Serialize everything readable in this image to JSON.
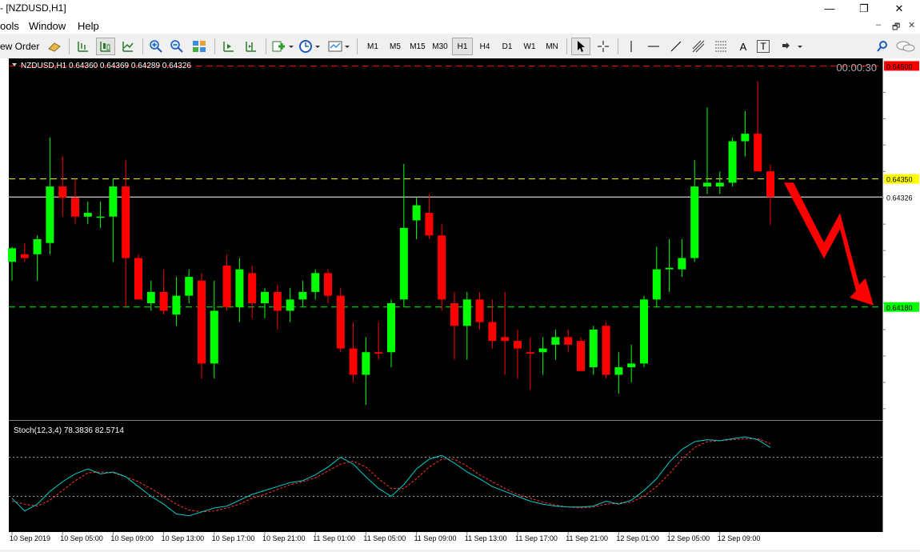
{
  "window": {
    "title": "- [NZDUSD,H1]",
    "buttons": {
      "minimize": "—",
      "maximize": "❐",
      "close": "✕"
    }
  },
  "menu": {
    "items": [
      "ools",
      "Window",
      "Help"
    ],
    "mdi": {
      "minimize": "–",
      "restore": "🗗",
      "close": "✕"
    }
  },
  "toolbar": {
    "new_order_label": "ew Order",
    "timeframes": [
      "M1",
      "M5",
      "M15",
      "M30",
      "H1",
      "H4",
      "D1",
      "W1",
      "MN"
    ],
    "active_timeframe": "H1",
    "text_tool_label": "A",
    "text_label_tool_label": "T",
    "icons": [
      "expert-advisor-icon",
      "bar-chart-icon",
      "candlestick-icon",
      "line-chart-icon",
      "zoom-in-icon",
      "zoom-out-icon",
      "tile-windows-icon",
      "autoscroll-icon",
      "chart-shift-icon",
      "indicators-icon",
      "periodicity-icon",
      "templates-icon",
      "cursor-icon",
      "crosshair-icon",
      "vertical-line-icon",
      "horizontal-line-icon",
      "trendline-icon",
      "channel-icon",
      "fibonacci-icon",
      "text-icon",
      "text-label-icon",
      "arrows-icon",
      "search-icon",
      "chat-icon"
    ]
  },
  "chart_data": {
    "type": "candlestick",
    "symbol_info": "NZDUSD,H1  0.64360 0.64369 0.64289 0.64326",
    "timer": "00:00:30",
    "colors": {
      "background": "#000000",
      "bull": "#00ff00",
      "bear": "#ff0000",
      "axis_text": "#ffffff"
    },
    "ylim": [
      0.6403,
      0.6451
    ],
    "y_ticks": [
      "0.64465",
      "0.64430",
      "0.64395",
      "0.64360",
      "0.64325",
      "0.64290",
      "0.64255",
      "0.64220",
      "0.64185",
      "0.64150",
      "0.64115",
      "0.64080",
      "0.64045"
    ],
    "price_labels": [
      {
        "value": "0.64500",
        "color": "#ff0000",
        "line": "dash",
        "text_color": "#000000"
      },
      {
        "value": "0.64350",
        "color": "#ffff00",
        "line": "dash",
        "text_color": "#000000"
      },
      {
        "value": "0.64326",
        "color": "#ffffff",
        "line": "solid",
        "text_color": "#000000"
      },
      {
        "value": "0.64180",
        "color": "#00ff00",
        "line": "dash",
        "text_color": "#000000"
      }
    ],
    "x_labels": [
      "10 Sep 2019",
      "10 Sep 05:00",
      "10 Sep 09:00",
      "10 Sep 13:00",
      "10 Sep 17:00",
      "10 Sep 21:00",
      "11 Sep 01:00",
      "11 Sep 05:00",
      "11 Sep 09:00",
      "11 Sep 13:00",
      "11 Sep 17:00",
      "11 Sep 21:00",
      "12 Sep 01:00",
      "12 Sep 05:00",
      "12 Sep 09:00"
    ],
    "candles": [
      [
        0.6424,
        0.6426,
        0.64215,
        0.64258
      ],
      [
        0.6425,
        0.64265,
        0.6424,
        0.64245
      ],
      [
        0.6425,
        0.64275,
        0.64215,
        0.6427
      ],
      [
        0.64265,
        0.64405,
        0.6425,
        0.6434
      ],
      [
        0.6434,
        0.6438,
        0.643,
        0.64325
      ],
      [
        0.64325,
        0.6435,
        0.6429,
        0.643
      ],
      [
        0.643,
        0.6432,
        0.6429,
        0.64305
      ],
      [
        0.643,
        0.6432,
        0.64285,
        0.643
      ],
      [
        0.643,
        0.6435,
        0.6424,
        0.6434
      ],
      [
        0.6434,
        0.64375,
        0.6418,
        0.64245
      ],
      [
        0.64245,
        0.6425,
        0.6419,
        0.6419
      ],
      [
        0.64185,
        0.64215,
        0.64175,
        0.642
      ],
      [
        0.642,
        0.6423,
        0.6417,
        0.64175
      ],
      [
        0.6417,
        0.6422,
        0.64155,
        0.64195
      ],
      [
        0.64195,
        0.6423,
        0.64185,
        0.6422
      ],
      [
        0.64215,
        0.64225,
        0.64085,
        0.64105
      ],
      [
        0.64105,
        0.64215,
        0.64085,
        0.64175
      ],
      [
        0.64235,
        0.6425,
        0.64175,
        0.6418
      ],
      [
        0.6418,
        0.64245,
        0.6416,
        0.6423
      ],
      [
        0.64225,
        0.64235,
        0.64165,
        0.64185
      ],
      [
        0.64185,
        0.64205,
        0.64165,
        0.642
      ],
      [
        0.642,
        0.6421,
        0.6415,
        0.64175
      ],
      [
        0.64175,
        0.64205,
        0.6416,
        0.6419
      ],
      [
        0.6419,
        0.64215,
        0.6418,
        0.642
      ],
      [
        0.642,
        0.6423,
        0.6419,
        0.64225
      ],
      [
        0.64225,
        0.6423,
        0.64185,
        0.64195
      ],
      [
        0.64195,
        0.64205,
        0.6412,
        0.64125
      ],
      [
        0.64125,
        0.6416,
        0.6408,
        0.6409
      ],
      [
        0.6409,
        0.6414,
        0.6405,
        0.6412
      ],
      [
        0.6412,
        0.6416,
        0.6411,
        0.64118
      ],
      [
        0.6412,
        0.6419,
        0.641,
        0.64185
      ],
      [
        0.6419,
        0.6437,
        0.6418,
        0.64285
      ],
      [
        0.64295,
        0.64325,
        0.6427,
        0.64315
      ],
      [
        0.64305,
        0.6433,
        0.6427,
        0.64275
      ],
      [
        0.64275,
        0.6429,
        0.64175,
        0.6419
      ],
      [
        0.64185,
        0.642,
        0.6411,
        0.64155
      ],
      [
        0.64155,
        0.642,
        0.6411,
        0.6419
      ],
      [
        0.6419,
        0.642,
        0.6415,
        0.6416
      ],
      [
        0.6416,
        0.6419,
        0.64125,
        0.64135
      ],
      [
        0.6414,
        0.642,
        0.6409,
        0.64135
      ],
      [
        0.64135,
        0.6415,
        0.64085,
        0.64125
      ],
      [
        0.6412,
        0.6414,
        0.6407,
        0.64118
      ],
      [
        0.6412,
        0.6414,
        0.6409,
        0.64125
      ],
      [
        0.6413,
        0.6415,
        0.6411,
        0.6414
      ],
      [
        0.6414,
        0.6415,
        0.6412,
        0.6413
      ],
      [
        0.64135,
        0.6414,
        0.64095,
        0.64095
      ],
      [
        0.641,
        0.64155,
        0.6409,
        0.6415
      ],
      [
        0.64155,
        0.6416,
        0.64085,
        0.6409
      ],
      [
        0.6409,
        0.6412,
        0.64065,
        0.641
      ],
      [
        0.641,
        0.6413,
        0.6408,
        0.64105
      ],
      [
        0.64105,
        0.64195,
        0.641,
        0.6419
      ],
      [
        0.6419,
        0.6426,
        0.6418,
        0.6423
      ],
      [
        0.6423,
        0.6427,
        0.642,
        0.64232
      ],
      [
        0.6423,
        0.6427,
        0.6422,
        0.64245
      ],
      [
        0.64245,
        0.64375,
        0.6424,
        0.6434
      ],
      [
        0.6434,
        0.64445,
        0.6433,
        0.64345
      ],
      [
        0.6434,
        0.6436,
        0.6433,
        0.64345
      ],
      [
        0.64345,
        0.64405,
        0.6434,
        0.644
      ],
      [
        0.644,
        0.6444,
        0.6438,
        0.6441
      ],
      [
        0.6441,
        0.6448,
        0.6436,
        0.6436
      ],
      [
        0.6436,
        0.64369,
        0.64289,
        0.64326
      ]
    ],
    "forecast_arrow": {
      "direction": "down",
      "color": "#ff0000"
    },
    "stochastic": {
      "label": "Stoch(12,3,4) 78.3836 82.5714",
      "levels": [
        100,
        70,
        30,
        0
      ],
      "dotted_levels": [
        70,
        30
      ],
      "main_color": "#00cccc",
      "signal_color": "#ff3333",
      "main": [
        28,
        15,
        22,
        35,
        45,
        53,
        58,
        53,
        55,
        50,
        40,
        30,
        22,
        12,
        10,
        14,
        18,
        20,
        26,
        32,
        36,
        40,
        44,
        46,
        52,
        60,
        70,
        63,
        50,
        38,
        30,
        42,
        58,
        68,
        72,
        64,
        55,
        48,
        40,
        35,
        30,
        25,
        22,
        20,
        19,
        19,
        20,
        25,
        22,
        26,
        36,
        48,
        65,
        78,
        86,
        88,
        87,
        89,
        91,
        88,
        80
      ],
      "signal": [
        25,
        22,
        20,
        26,
        36,
        46,
        54,
        55,
        54,
        50,
        45,
        38,
        30,
        22,
        16,
        14,
        15,
        18,
        22,
        28,
        32,
        37,
        42,
        45,
        49,
        56,
        63,
        66,
        60,
        48,
        38,
        38,
        48,
        60,
        68,
        68,
        61,
        52,
        45,
        38,
        32,
        28,
        24,
        21,
        19,
        18,
        19,
        22,
        23,
        24,
        30,
        40,
        53,
        68,
        80,
        86,
        87,
        88,
        89,
        89,
        84
      ]
    }
  }
}
